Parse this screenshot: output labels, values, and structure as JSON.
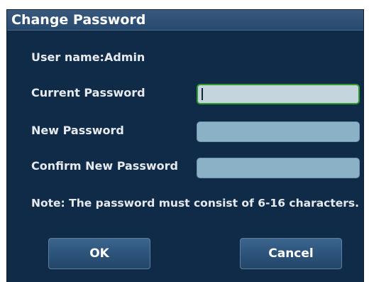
{
  "dialog": {
    "title": "Change Password",
    "user_label": "User name:Admin",
    "current_password_label": "Current Password",
    "new_password_label": "New Password",
    "confirm_password_label": "Confirm New Password",
    "note": "Note: The password must consist of 6-16 characters.",
    "fields": {
      "current_value": "",
      "new_value": "",
      "confirm_value": ""
    },
    "buttons": {
      "ok_label": "OK",
      "cancel_label": "Cancel"
    },
    "colors": {
      "background": "#102b48",
      "titlebar": "#2f5176",
      "field": "#8ab1c6",
      "active_field_border": "#2f9a2c"
    }
  }
}
